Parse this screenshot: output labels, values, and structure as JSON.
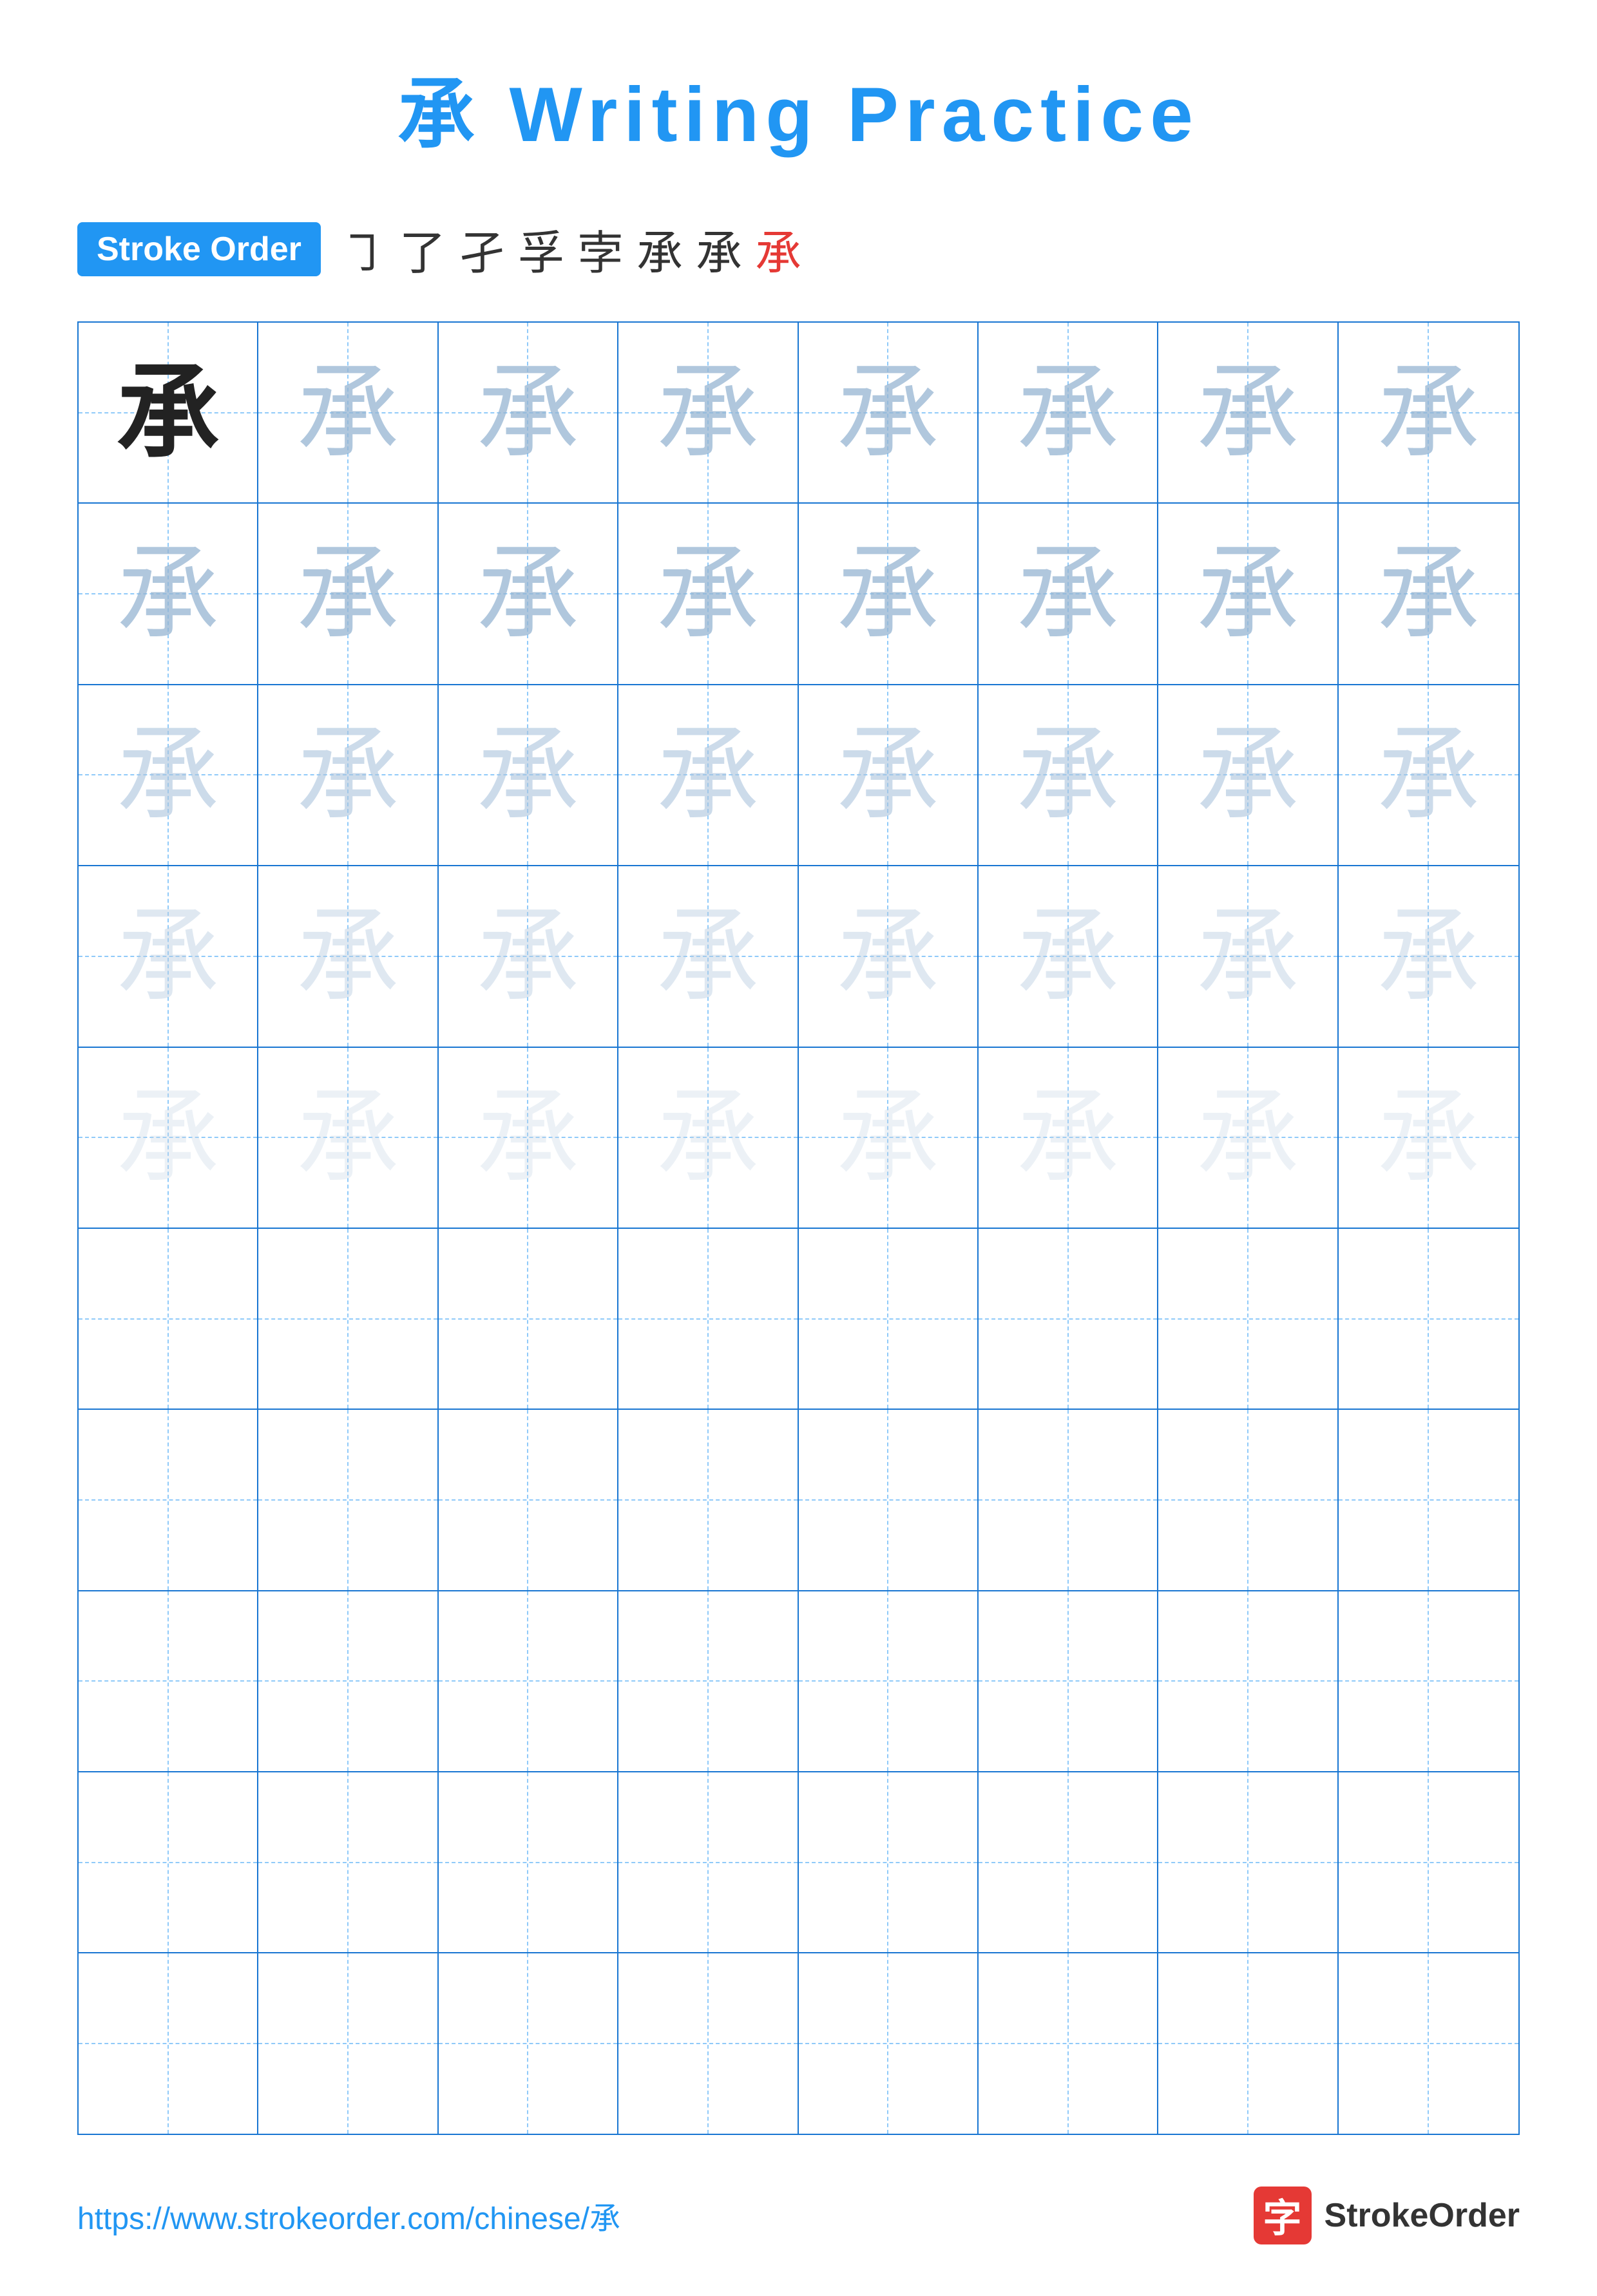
{
  "header": {
    "title": "承 Writing Practice",
    "char": "承",
    "title_suffix": " Writing Practice"
  },
  "stroke_order": {
    "badge_label": "Stroke Order",
    "sequence": [
      "㇆",
      "了",
      "孑",
      "孚",
      "孛",
      "承̲",
      "承̃",
      "承"
    ],
    "chars": [
      {
        "text": "㇆",
        "style": "normal"
      },
      {
        "text": "了",
        "style": "normal"
      },
      {
        "text": "孑",
        "style": "normal"
      },
      {
        "text": "孚",
        "style": "normal"
      },
      {
        "text": "孛",
        "style": "normal"
      },
      {
        "text": "承",
        "style": "normal"
      },
      {
        "text": "承",
        "style": "normal"
      },
      {
        "text": "承",
        "style": "red"
      }
    ]
  },
  "practice_char": "承",
  "grid": {
    "rows": 10,
    "cols": 8,
    "filled_rows": 5,
    "row_styles": [
      "dark",
      "light-1",
      "light-2",
      "light-3",
      "light-4"
    ]
  },
  "footer": {
    "url": "https://www.strokeorder.com/chinese/承",
    "logo_text": "StrokeOrder",
    "logo_icon": "字"
  }
}
